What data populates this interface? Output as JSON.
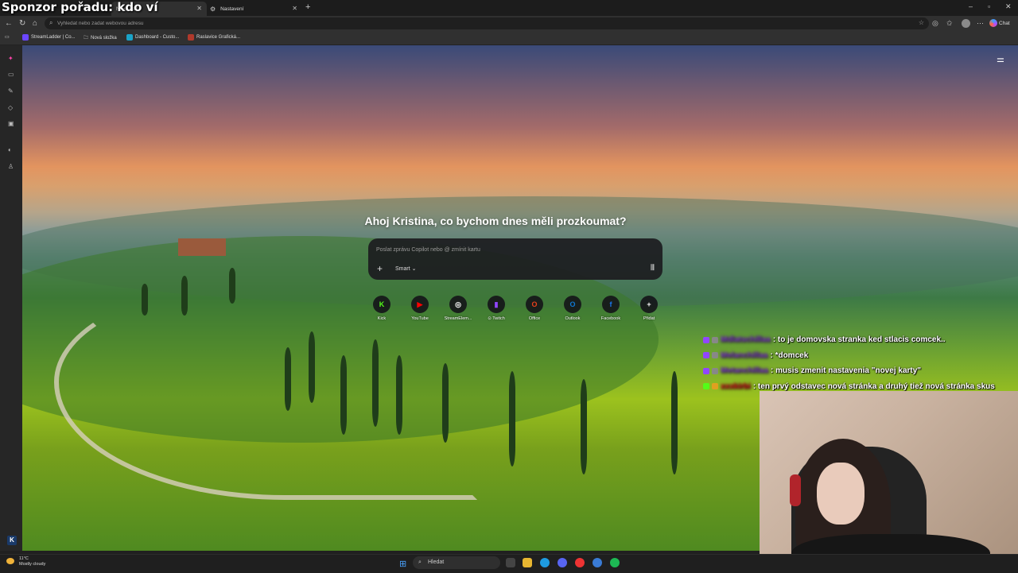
{
  "overlay": {
    "sponsor_text": "Sponzor pořadu: kdo ví"
  },
  "tabs": [
    {
      "label": "Nová karta",
      "close": "✕"
    },
    {
      "label": "Nastavení",
      "close": "✕"
    }
  ],
  "new_tab_symbol": "+",
  "address": {
    "placeholder": "Vyhledat nebo zadat webovou adresu"
  },
  "toolbar": {
    "chat_label": "Chat"
  },
  "favorites": [
    {
      "label": "StreamLadder | Co..."
    },
    {
      "label": "Nová složka"
    },
    {
      "label": "Dashboard - Custo..."
    },
    {
      "label": "Raslavice Grafická..."
    }
  ],
  "newtab": {
    "greeting": "Ahoj Kristina, co bychom dnes měli prozkoumat?",
    "prompt_placeholder": "Poslat zprávu Copilot nebo @ zmínit kartu",
    "mode_label": "Smart",
    "shortcuts": [
      {
        "label": "Kick",
        "glyph": "K",
        "color": "#53fc18"
      },
      {
        "label": "YouTube",
        "glyph": "▶",
        "color": "#ff0000"
      },
      {
        "label": "StreamElem...",
        "glyph": "◎",
        "color": "#ffffff"
      },
      {
        "label": "⊙ Twitch",
        "glyph": "▮",
        "color": "#9146ff"
      },
      {
        "label": "Office",
        "glyph": "O",
        "color": "#e8401c"
      },
      {
        "label": "Outlook",
        "glyph": "O",
        "color": "#0f78d4"
      },
      {
        "label": "Facebook",
        "glyph": "f",
        "color": "#1877f2"
      },
      {
        "label": "Přidat",
        "glyph": "+",
        "color": "#ffffff"
      }
    ]
  },
  "chat": [
    {
      "user": "Mdlatschillaa",
      "message": ": to je domovska stranka ked stlacis comcek..",
      "color": "#8f4fd8"
    },
    {
      "user": "Melanchillaa",
      "message": ": *domcek",
      "color": "#8f4fd8"
    },
    {
      "user": "Metanchillaa",
      "message": ": musis zmenit nastavenia \"novej karty\"",
      "color": "#8f4fd8"
    },
    {
      "user": "xxxkirbi",
      "message": ": ten prvý odstavec nová stránka a druhý tiež nová stránka skus",
      "color": "#e6191e"
    }
  ],
  "taskbar": {
    "temperature": "11°C",
    "weather": "Mostly cloudy",
    "search_label": "Hledat"
  },
  "colors": {
    "accent": "#4aa3ff",
    "chrome_bg": "#303030",
    "tab_bar": "#1c1c1c"
  }
}
